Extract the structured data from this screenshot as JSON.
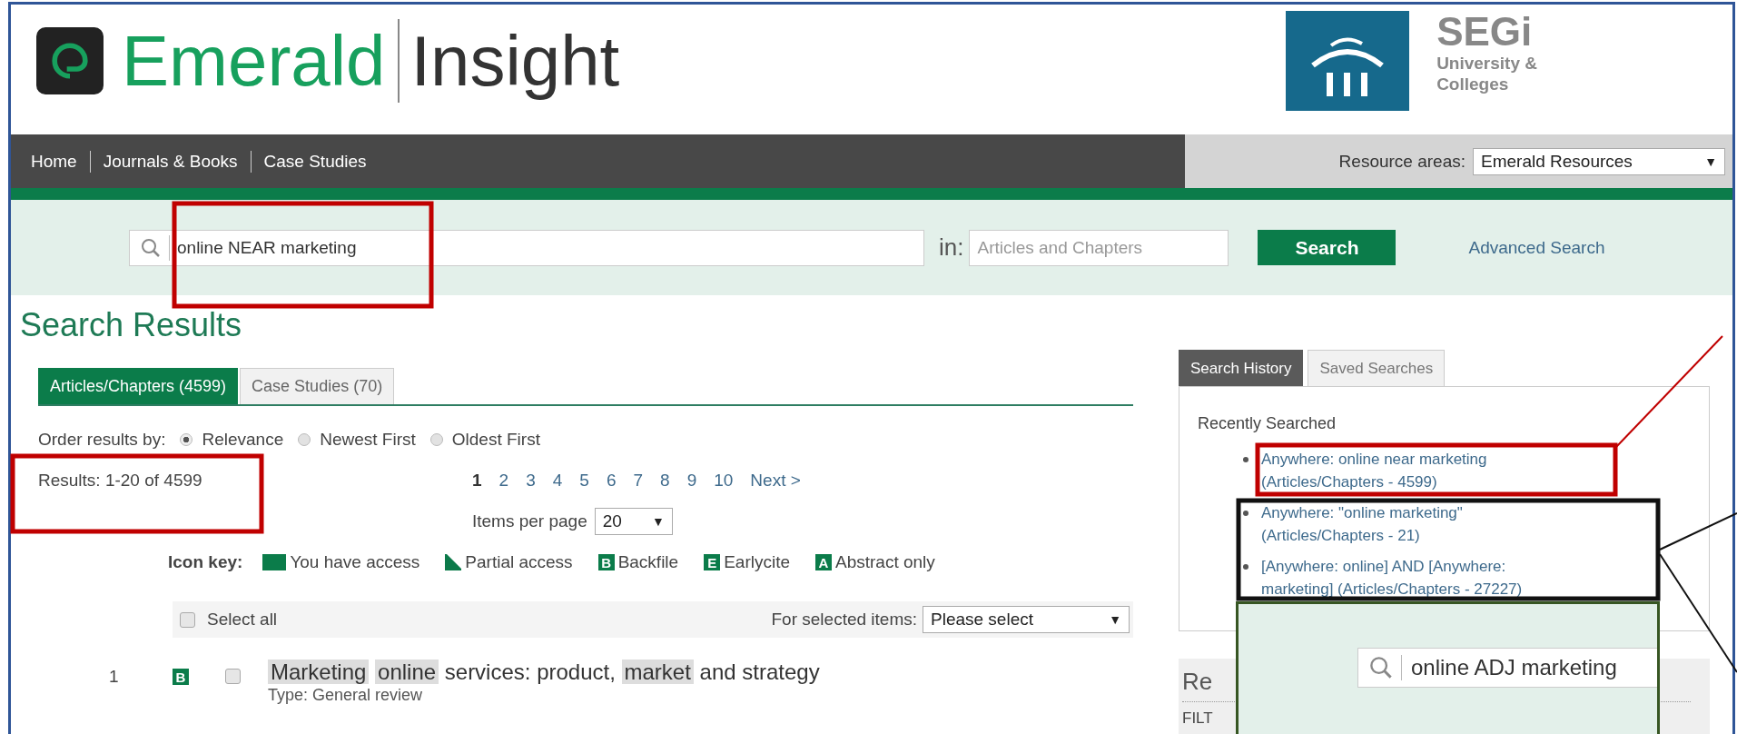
{
  "header": {
    "logo": {
      "brand": "Emerald",
      "product": "Insight"
    },
    "institution": {
      "name": "SEGi",
      "line_1": "University &",
      "line_2": "Colleges"
    }
  },
  "nav": {
    "items": [
      {
        "label": "Home"
      },
      {
        "label": "Journals & Books"
      },
      {
        "label": "Case Studies"
      }
    ],
    "resource_areas": {
      "label": "Resource areas:",
      "value": "Emerald Resources",
      "caret": "▼"
    }
  },
  "search": {
    "query": "online NEAR marketing",
    "in_label": "in:",
    "scope_placeholder": "Articles and Chapters",
    "button": "Search",
    "advanced": "Advanced Search"
  },
  "heading": "Search Results",
  "tabs": [
    {
      "label": "Articles/Chapters (4599)",
      "selected": true
    },
    {
      "label": "Case Studies (70)",
      "selected": false
    }
  ],
  "order": {
    "label": "Order results by:",
    "options": [
      {
        "label": "Relevance",
        "selected": true
      },
      {
        "label": "Newest First",
        "selected": false
      },
      {
        "label": "Oldest First",
        "selected": false
      }
    ]
  },
  "results_count": "Results: 1-20 of 4599",
  "pagination": {
    "pages": [
      {
        "label": "1",
        "selected": true
      },
      {
        "label": "2",
        "selected": false
      },
      {
        "label": "3",
        "selected": false
      },
      {
        "label": "4",
        "selected": false
      },
      {
        "label": "5",
        "selected": false
      },
      {
        "label": "6",
        "selected": false
      },
      {
        "label": "7",
        "selected": false
      },
      {
        "label": "8",
        "selected": false
      },
      {
        "label": "9",
        "selected": false
      },
      {
        "label": "10",
        "selected": false
      }
    ],
    "next": "Next >"
  },
  "items_per_page": {
    "label": "Items per page",
    "value": "20",
    "caret": "▼"
  },
  "icon_key": {
    "label": "Icon key:",
    "items": [
      {
        "kind": "full",
        "label": "You have access"
      },
      {
        "kind": "partial",
        "label": "Partial access"
      },
      {
        "kind": "letter",
        "letter": "B",
        "label": "Backfile"
      },
      {
        "kind": "letter",
        "letter": "E",
        "label": "Earlycite"
      },
      {
        "kind": "letter",
        "letter": "A",
        "label": "Abstract only"
      }
    ]
  },
  "bulk": {
    "select_all": "Select all",
    "checked": false,
    "for_selected": "For selected items:",
    "value": "Please select",
    "caret": "▼"
  },
  "results": [
    {
      "number": "1",
      "badge": "B",
      "checked": false,
      "title_parts": [
        {
          "text": "Marketing",
          "highlighted": true
        },
        {
          "text": "online",
          "highlighted": true
        },
        {
          "text": "services: product,",
          "highlighted": false
        },
        {
          "text": "market",
          "highlighted": true
        },
        {
          "text": "and strategy",
          "highlighted": false
        }
      ],
      "type": "Type: General review"
    }
  ],
  "side_tabs": [
    {
      "label": "Search History",
      "selected": true
    },
    {
      "label": "Saved Searches",
      "selected": false
    }
  ],
  "history": {
    "heading": "Recently Searched",
    "items": [
      {
        "line_1": "Anywhere: online near marketing",
        "line_2": "(Articles/Chapters - 4599)"
      },
      {
        "line_1": "Anywhere: \"online marketing\"",
        "line_2": "(Articles/Chapters - 21)"
      },
      {
        "line_1": "[Anywhere: online] AND [Anywhere:",
        "line_2": "marketing] (Articles/Chapters - 27227)"
      }
    ]
  },
  "refine_panel": {
    "heading": "Re",
    "filter_label": "FILT"
  },
  "callout": {
    "query": "online ADJ marketing"
  }
}
